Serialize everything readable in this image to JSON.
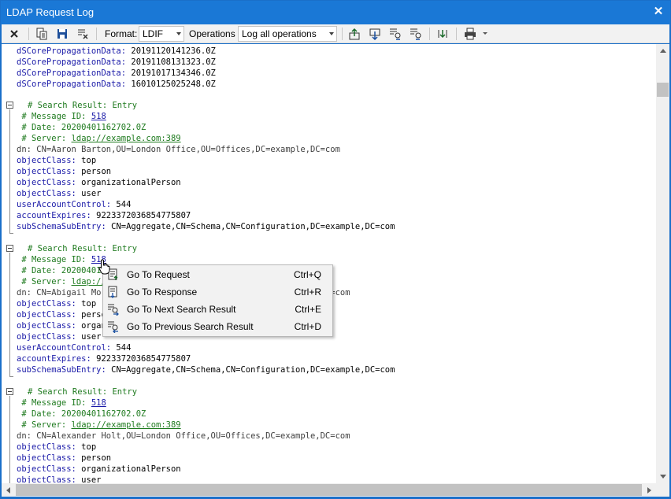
{
  "window": {
    "title": "LDAP Request Log"
  },
  "toolbar": {
    "format_label": "Format:",
    "format_value": "LDIF",
    "operations_label": "Operations",
    "operations_value": "Log all operations",
    "icons": [
      "close-icon",
      "copy-icon",
      "save-icon",
      "clear-icon",
      "export-up-icon",
      "import-down-icon",
      "find-next-icon",
      "find-previous-icon",
      "refresh-icon",
      "print-icon",
      "dropdown-arrow-icon"
    ]
  },
  "log": {
    "top_attrs": [
      {
        "key": "dSCorePropagationData:",
        "value": " 20191120141236.0Z"
      },
      {
        "key": "dSCorePropagationData:",
        "value": " 20191108131323.0Z"
      },
      {
        "key": "dSCorePropagationData:",
        "value": " 20191017134346.0Z"
      },
      {
        "key": "dSCorePropagationData:",
        "value": " 16010125025248.0Z"
      }
    ],
    "entries": [
      {
        "header": "# Search Result: Entry",
        "message_prefix": " # Message ID: ",
        "message_id": "518",
        "date": " # Date: 20200401162702.0Z",
        "server_prefix": " # Server: ",
        "server": "ldap://example.com:389",
        "dn": "dn: CN=Aaron Barton,OU=London Office,OU=Offices,DC=example,DC=com",
        "attrs": [
          {
            "key": "objectClass:",
            "value": " top"
          },
          {
            "key": "objectClass:",
            "value": " person"
          },
          {
            "key": "objectClass:",
            "value": " organizationalPerson"
          },
          {
            "key": "objectClass:",
            "value": " user"
          },
          {
            "key": "userAccountControl:",
            "value": " 544"
          },
          {
            "key": "accountExpires:",
            "value": " 9223372036854775807"
          },
          {
            "key": "subSchemaSubEntry:",
            "value": " CN=Aggregate,CN=Schema,CN=Configuration,DC=example,DC=com"
          }
        ]
      },
      {
        "header": "# Search Result: Entry",
        "message_prefix": " # Message ID: ",
        "message_id": "518",
        "date": " # Date: 20200401162702.0Z",
        "server_prefix": " # Server: ",
        "server": "ldap://example.com:389",
        "dn": "dn: CN=Abigail Morris,OU=London Office,OU=Offices,DC=example,DC=com",
        "attrs": [
          {
            "key": "objectClass:",
            "value": " top"
          },
          {
            "key": "objectClass:",
            "value": " person"
          },
          {
            "key": "objectClass:",
            "value": " organizationalPerson"
          },
          {
            "key": "objectClass:",
            "value": " user"
          },
          {
            "key": "userAccountControl:",
            "value": " 544"
          },
          {
            "key": "accountExpires:",
            "value": " 9223372036854775807"
          },
          {
            "key": "subSchemaSubEntry:",
            "value": " CN=Aggregate,CN=Schema,CN=Configuration,DC=example,DC=com"
          }
        ]
      },
      {
        "header": "# Search Result: Entry",
        "message_prefix": " # Message ID: ",
        "message_id": "518",
        "date": " # Date: 20200401162702.0Z",
        "server_prefix": " # Server: ",
        "server": "ldap://example.com:389",
        "dn": "dn: CN=Alexander Holt,OU=London Office,OU=Offices,DC=example,DC=com",
        "attrs": [
          {
            "key": "objectClass:",
            "value": " top"
          },
          {
            "key": "objectClass:",
            "value": " person"
          },
          {
            "key": "objectClass:",
            "value": " organizationalPerson"
          },
          {
            "key": "objectClass:",
            "value": " user"
          }
        ]
      }
    ]
  },
  "context_menu": {
    "items": [
      {
        "label": "Go To Request",
        "shortcut": "Ctrl+Q",
        "icon": "go-to-request-icon"
      },
      {
        "label": "Go To Response",
        "shortcut": "Ctrl+R",
        "icon": "go-to-response-icon"
      },
      {
        "label": "Go To Next Search Result",
        "shortcut": "Ctrl+E",
        "icon": "next-search-result-icon"
      },
      {
        "label": "Go To Previous Search Result",
        "shortcut": "Ctrl+D",
        "icon": "previous-search-result-icon"
      }
    ]
  },
  "colors": {
    "titlebar": "#1a78d6",
    "attribute_key": "#1a1aa8",
    "comment": "#1e7a1e",
    "link": "#1a1aa8"
  }
}
